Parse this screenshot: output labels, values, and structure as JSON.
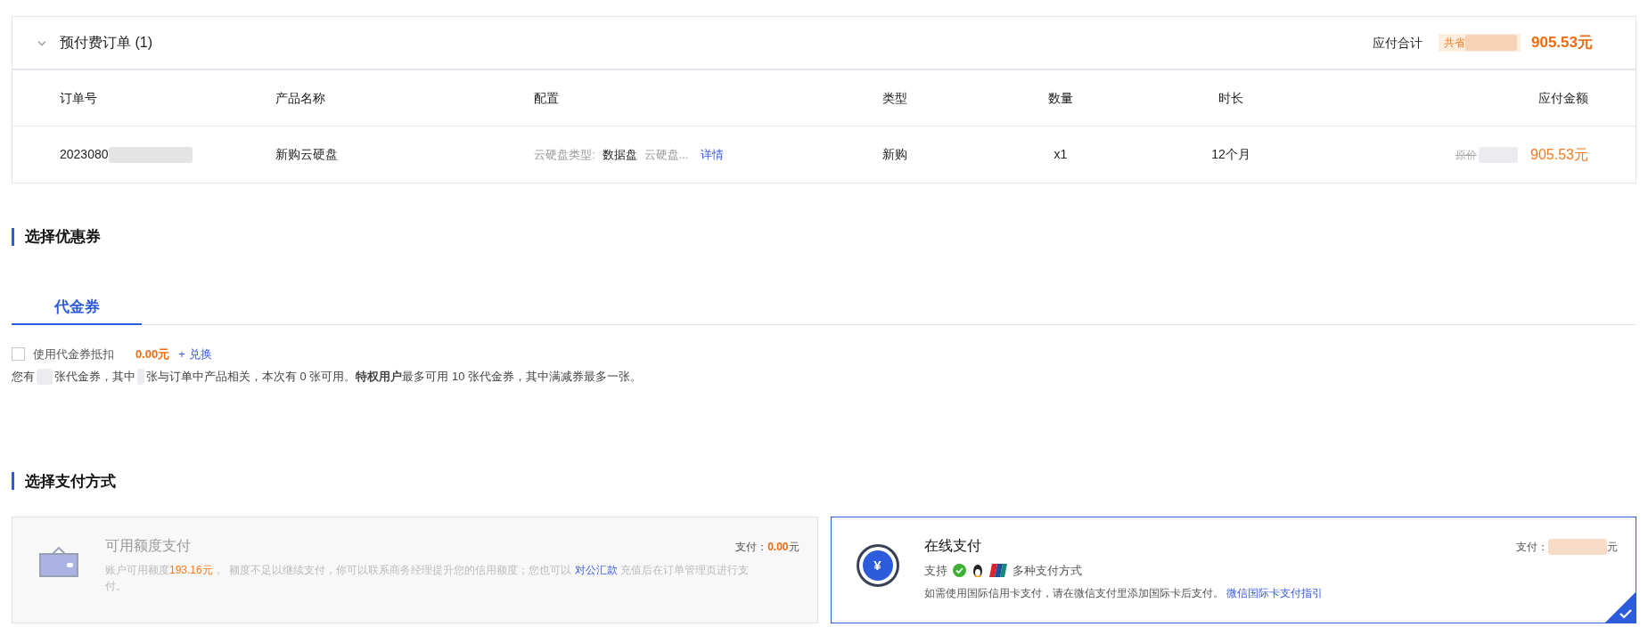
{
  "order_group": {
    "title": "预付费订单 (1)",
    "expanded": true,
    "total_label": "应付合计",
    "savings_label": "共省",
    "total": "905.53元",
    "table": {
      "columns": [
        "订单号",
        "产品名称",
        "配置",
        "类型",
        "数量",
        "时长",
        "应付金额"
      ],
      "rows": [
        {
          "order_no": "2023080",
          "product": "新购云硬盘",
          "config": [
            {
              "kind": "label",
              "text": "云硬盘类型:"
            },
            {
              "kind": "value",
              "text": "数据盘"
            },
            {
              "kind": "label",
              "text": "云硬盘..."
            }
          ],
          "detail_link": "详情",
          "type": "新购",
          "quantity": "x1",
          "duration": "12个月",
          "original_price_label": "原价",
          "amount": "905.53元"
        }
      ]
    }
  },
  "coupon_section": {
    "title": "选择优惠券",
    "tabs": [
      {
        "label": "代金券",
        "selected": true
      }
    ],
    "use_coupon": {
      "label": "使用代金券抵扣",
      "checked": false,
      "amount": "0.00元",
      "redeem_link": "+ 兑换"
    },
    "notice_parts": [
      "您有",
      "张代金券，其中",
      "张与订单中产品相关，本次有 0 张可用。**特权用户**最多可用 10 张代金券，其中满减券最多一张。"
    ]
  },
  "payment_section": {
    "title": "选择支付方式",
    "methods": [
      {
        "kind": "credit",
        "title": "可用额度支付",
        "disabled": true,
        "selected": false,
        "pay_label": "支付：",
        "pay_amount": "0.00",
        "pay_unit": "元",
        "description": [
          {
            "kind": "text",
            "text": "账户可用额度"
          },
          {
            "kind": "highlight",
            "text": "193.16元"
          },
          {
            "kind": "text",
            "text": "，  额度不足以继续支付，你可以联系商务经理提升您的信用额度；您也可以 "
          },
          {
            "kind": "link",
            "text": "对公汇款"
          },
          {
            "kind": "text",
            "text": " 充值后在订单管理页进行支付。"
          }
        ]
      },
      {
        "kind": "online",
        "title": "在线支付",
        "disabled": false,
        "selected": true,
        "icon_symbol": "¥",
        "pay_label": "支付：",
        "pay_unit": "元",
        "support_label": "支持",
        "support_suffix": "多种支付方式",
        "description": [
          {
            "kind": "text",
            "text": "如需使用国际信用卡支付，请在微信支付里添加国际卡后支付。 "
          },
          {
            "kind": "link",
            "text": "微信国际卡支付指引"
          }
        ]
      }
    ]
  }
}
